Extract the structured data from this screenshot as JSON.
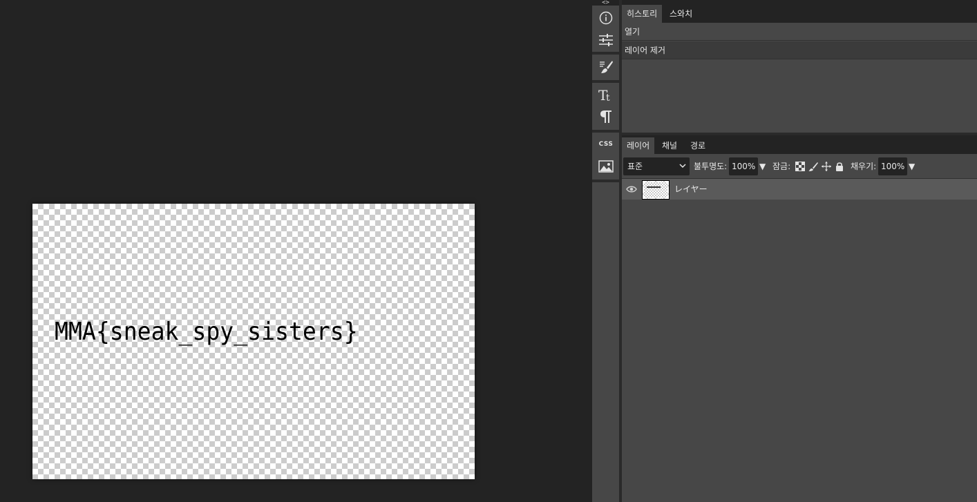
{
  "canvas": {
    "text": "MMA{sneak_spy_sisters}"
  },
  "toolbar": {
    "collapse_label": "<>",
    "tools": [
      "info-icon",
      "adjustments-icon",
      "brush-settings-icon",
      "character-icon",
      "paragraph-icon",
      "css-icon",
      "image-icon"
    ],
    "css_label": "CSS"
  },
  "history_panel": {
    "tabs": [
      {
        "label": "히스토리",
        "active": true
      },
      {
        "label": "스와치",
        "active": false
      }
    ],
    "items": [
      {
        "label": "열기",
        "active": false
      },
      {
        "label": "레이어 제거",
        "active": true
      }
    ]
  },
  "layers_panel": {
    "tabs": [
      {
        "label": "레이어",
        "active": true
      },
      {
        "label": "채널",
        "active": false
      },
      {
        "label": "경로",
        "active": false
      }
    ],
    "blend_mode": "표준",
    "opacity_label": "불투명도:",
    "opacity_value": "100%",
    "lock_label": "잠금:",
    "fill_label": "채우기:",
    "fill_value": "100%",
    "layers": [
      {
        "name": "レイヤー",
        "visible": true
      }
    ]
  },
  "colors": {
    "workspace_bg": "#232323",
    "panel_bg": "#474747",
    "selected_layer_bg": "#5a5a5a"
  }
}
